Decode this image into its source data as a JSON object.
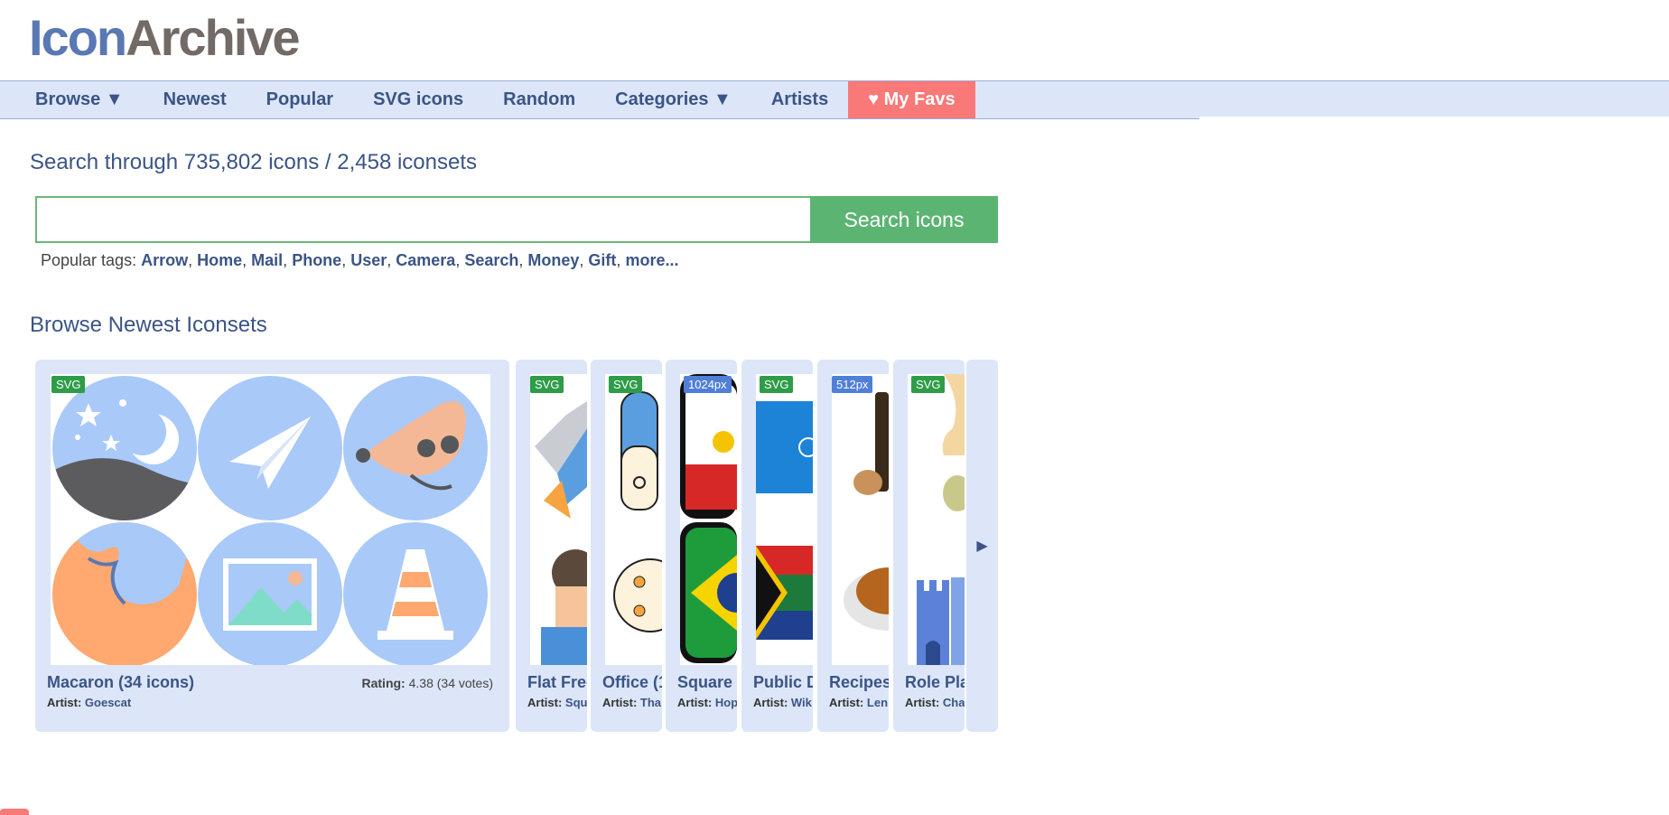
{
  "logo": {
    "part1": "Icon",
    "part2": "Archive"
  },
  "nav": [
    {
      "label": "Browse ▼"
    },
    {
      "label": "Newest"
    },
    {
      "label": "Popular"
    },
    {
      "label": "SVG icons"
    },
    {
      "label": "Random"
    },
    {
      "label": "Categories ▼"
    },
    {
      "label": "Artists"
    },
    {
      "label": "♥ My Favs"
    }
  ],
  "search": {
    "title": "Search through 735,802 icons / 2,458 iconsets",
    "placeholder": "",
    "button": "Search icons"
  },
  "tags": {
    "label": "Popular tags:",
    "items": [
      "Arrow",
      "Home",
      "Mail",
      "Phone",
      "User",
      "Camera",
      "Search",
      "Money",
      "Gift",
      "more..."
    ]
  },
  "browse": {
    "title": "Browse Newest Iconsets"
  },
  "iconsets": [
    {
      "badge": "SVG",
      "name": "Macaron (34 icons)",
      "artist_label": "Artist:",
      "artist": "Goescat",
      "rating_label": "Rating:",
      "rating": "4.38 (34 votes)"
    },
    {
      "badge": "SVG",
      "name": "Flat Free",
      "artist_label": "Artist:",
      "artist": "Squ"
    },
    {
      "badge": "SVG",
      "name": "Office (1",
      "artist_label": "Artist:",
      "artist": "Tha"
    },
    {
      "badge": "1024px",
      "name": "Square",
      "artist_label": "Artist:",
      "artist": "Hop"
    },
    {
      "badge": "SVG",
      "name": "Public D",
      "artist_label": "Artist:",
      "artist": "Wik"
    },
    {
      "badge": "512px",
      "name": "Recipes",
      "artist_label": "Artist:",
      "artist": "Len"
    },
    {
      "badge": "SVG",
      "name": "Role Pla",
      "artist_label": "Artist:",
      "artist": "Cha"
    }
  ],
  "carousel_next": "▶",
  "colors": {
    "accent": "#3b5486",
    "nav_bg": "#dce6f8",
    "fav": "#f97878",
    "search_btn": "#5cb472",
    "svg_badge": "#2e9c48",
    "px_badge": "#4f7fd8"
  }
}
